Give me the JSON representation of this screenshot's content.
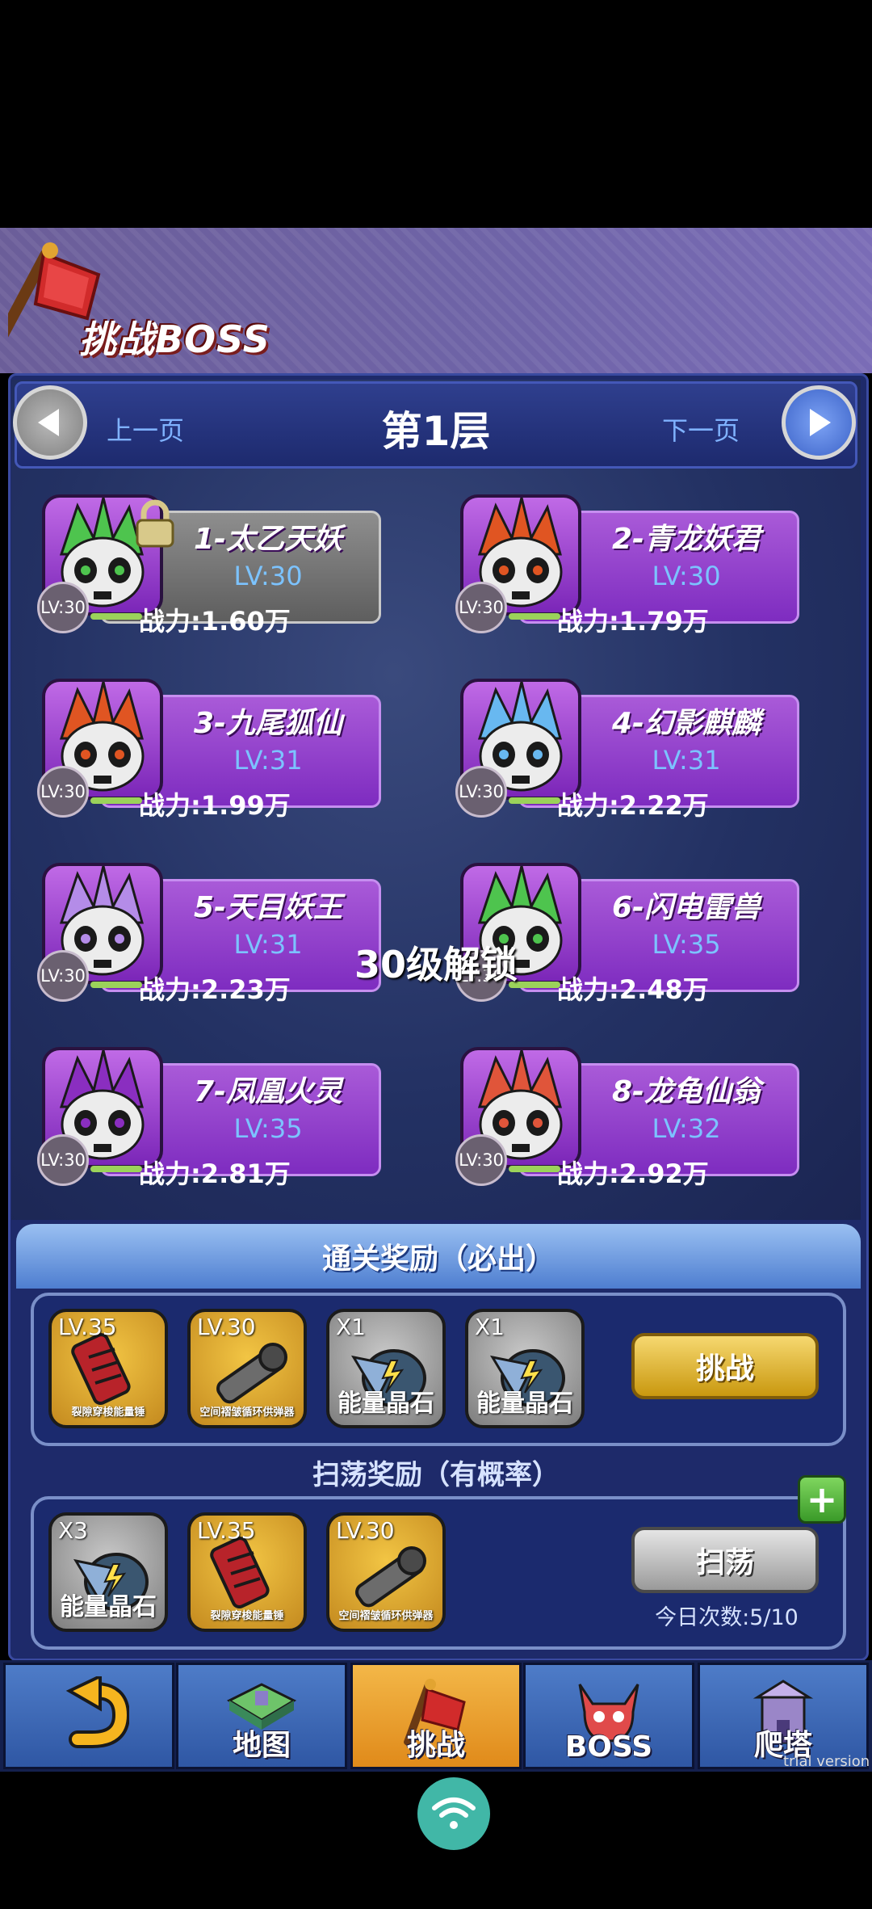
{
  "header": {
    "title": "挑战BOSS"
  },
  "floor_nav": {
    "prev_label": "上一页",
    "title": "第1层",
    "next_label": "下一页"
  },
  "bosses": [
    {
      "name": "1-太乙天妖",
      "lv": "LV:30",
      "power": "战力:1.60万",
      "badge": "LV:30",
      "locked": true,
      "color": "#4ec44e"
    },
    {
      "name": "2-青龙妖君",
      "lv": "LV:30",
      "power": "战力:1.79万",
      "badge": "LV:30",
      "locked": false,
      "color": "#e05522"
    },
    {
      "name": "3-九尾狐仙",
      "lv": "LV:31",
      "power": "战力:1.99万",
      "badge": "LV:30",
      "locked": false,
      "color": "#e05522"
    },
    {
      "name": "4-幻影麒麟",
      "lv": "LV:31",
      "power": "战力:2.22万",
      "badge": "LV:30",
      "locked": false,
      "color": "#68b8f0"
    },
    {
      "name": "5-天目妖王",
      "lv": "LV:31",
      "power": "战力:2.23万",
      "badge": "LV:30",
      "locked": false,
      "color": "#b48ce8"
    },
    {
      "name": "6-闪电雷兽",
      "lv": "LV:35",
      "power": "战力:2.48万",
      "badge": "LV:30",
      "locked": false,
      "color": "#4ec44e"
    },
    {
      "name": "7-凤凰火灵",
      "lv": "LV:35",
      "power": "战力:2.81万",
      "badge": "LV:30",
      "locked": false,
      "color": "#8a2ec0"
    },
    {
      "name": "8-龙龟仙翁",
      "lv": "LV:32",
      "power": "战力:2.92万",
      "badge": "LV:30",
      "locked": false,
      "color": "#e0553a"
    }
  ],
  "unlock_notice": "30级解锁",
  "clear_rewards": {
    "title": "通关奖励（必出）",
    "items": [
      {
        "tag": "LV.35",
        "name": "裂隙穿梭能量锤",
        "style": "gold",
        "icon": "hammer-icon"
      },
      {
        "tag": "LV.30",
        "name": "空间褶皱循环供弹器",
        "style": "gold",
        "icon": "cannon-icon"
      },
      {
        "tag": "X1",
        "name": "能量晶石",
        "style": "gray",
        "icon": "crystal-icon"
      },
      {
        "tag": "X1",
        "name": "能量晶石",
        "style": "gray",
        "icon": "crystal-icon"
      }
    ],
    "button": "挑战"
  },
  "sweep_rewards": {
    "title": "扫荡奖励（有概率）",
    "items": [
      {
        "tag": "X3",
        "name": "能量晶石",
        "style": "gray",
        "icon": "crystal-icon"
      },
      {
        "tag": "LV.35",
        "name": "裂隙穿梭能量锤",
        "style": "gold",
        "icon": "hammer-icon"
      },
      {
        "tag": "LV.30",
        "name": "空间褶皱循环供弹器",
        "style": "gold",
        "icon": "cannon-icon"
      }
    ],
    "button": "扫荡",
    "plus": "+",
    "daily_count": "今日次数:5/10"
  },
  "nav": {
    "tabs": [
      {
        "label": "",
        "icon": "back-arrow-icon"
      },
      {
        "label": "地图",
        "icon": "map-icon"
      },
      {
        "label": "挑战",
        "icon": "flag-icon",
        "active": true
      },
      {
        "label": "BOSS",
        "icon": "demon-icon"
      },
      {
        "label": "爬塔",
        "icon": "tower-icon"
      }
    ]
  },
  "watermark": "trial version"
}
